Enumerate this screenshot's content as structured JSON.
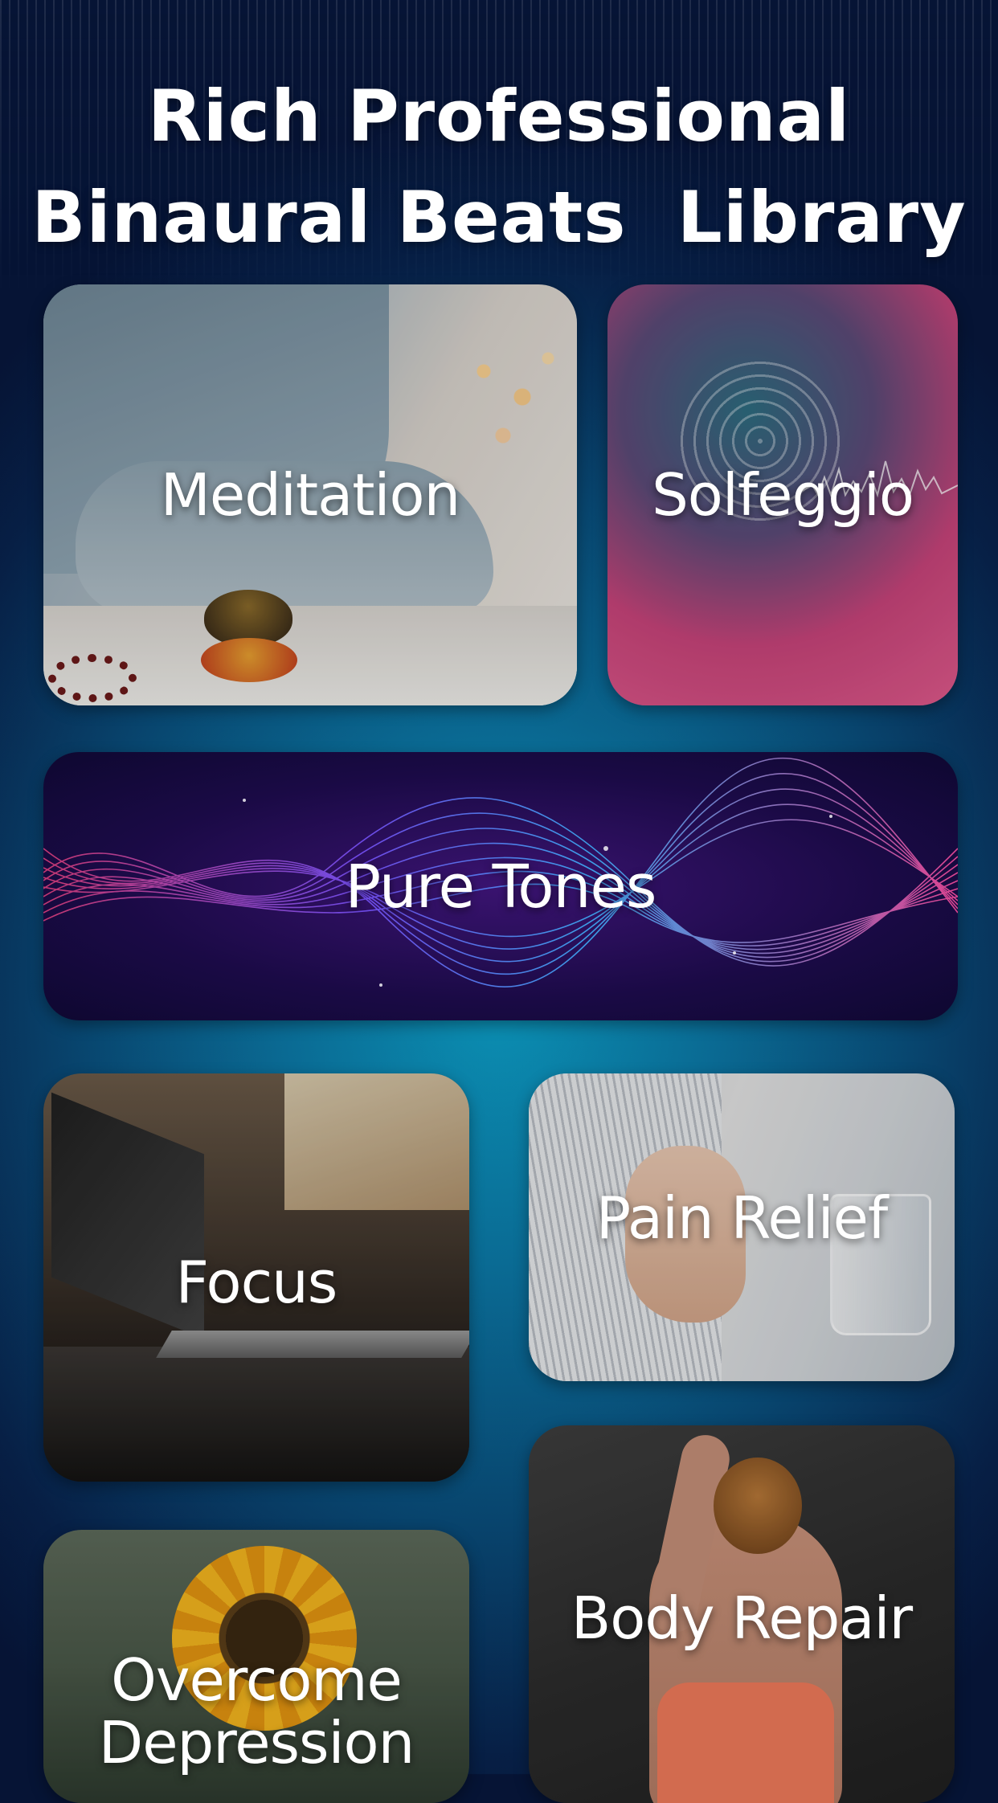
{
  "header": {
    "line1": "Rich Professional",
    "line2": "Binaural Beats  Library"
  },
  "categories": {
    "meditation": "Meditation",
    "solfeggio": "Solfeggio",
    "pure_tones": "Pure Tones",
    "focus": "Focus",
    "pain_relief": "Pain Relief",
    "overcome_depression_line1": "Overcome",
    "overcome_depression_line2": "Depression",
    "body_repair": "Body Repair"
  },
  "colors": {
    "background_center": "#0b8fb3",
    "background_edge": "#061435",
    "text": "#ffffff"
  }
}
